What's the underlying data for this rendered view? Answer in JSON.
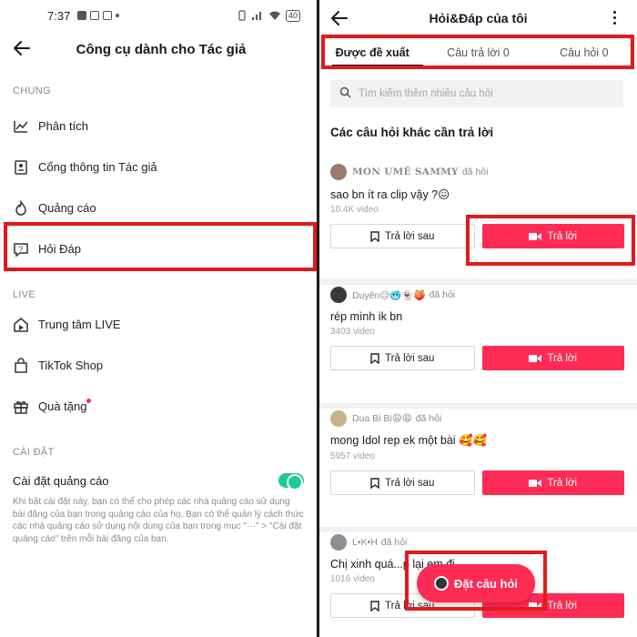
{
  "left": {
    "status": {
      "time": "7:37",
      "battery": "40"
    },
    "title": "Công cụ dành cho Tác giả",
    "sections": [
      {
        "label": "CHUNG",
        "items": [
          "Phân tích",
          "Cổng thông tin Tác giả",
          "Quảng cáo",
          "Hỏi Đáp"
        ]
      },
      {
        "label": "LIVE",
        "items": [
          "Trung tâm LIVE",
          "TikTok Shop",
          "Quà tặng"
        ]
      },
      {
        "label": "CÀI ĐẶT"
      }
    ],
    "ad_setting": {
      "label": "Cài đặt quảng cáo",
      "description": "Khi bật cài đặt này, bạn có thể cho phép các nhà quảng cáo sử dụng bài đăng của bạn trong quảng cáo của họ. Bạn có thể quản lý cách thức các nhà quảng cáo sử dụng nội dung của bạn trong mục \"···\" > \"Cài đặt quảng cáo\" trên mỗi bài đăng của bạn."
    }
  },
  "right": {
    "title": "Hỏi&Đáp của tôi",
    "tabs": [
      "Được đề xuất",
      "Câu trả lời 0",
      "Câu hỏi 0"
    ],
    "search_placeholder": "Tìm kiếm thêm nhiều câu hỏi",
    "section_title": "Các câu hỏi khác cần trả lời",
    "asked_suffix": "đã hỏi",
    "later_label": "Trả lời sau",
    "reply_label": "Trả lời",
    "questions": [
      {
        "user": "MON UMÊ SAMMY",
        "question": "sao bn ít ra clip vậy ?😖",
        "views": "10.4K video"
      },
      {
        "user": "Duyên😥🥶👻🍑",
        "question": "rép mình ik bn",
        "views": "3403 video"
      },
      {
        "user": "Dua Bi Bi😩😩",
        "question": "mong Idol rep ek một bài 🥰🥰",
        "views": "5957 video"
      },
      {
        "user": "L•K•H",
        "question": "Chị xinh quá...p lại em đi",
        "views": "1016 video"
      }
    ],
    "fab_label": "Đặt câu hỏi"
  }
}
